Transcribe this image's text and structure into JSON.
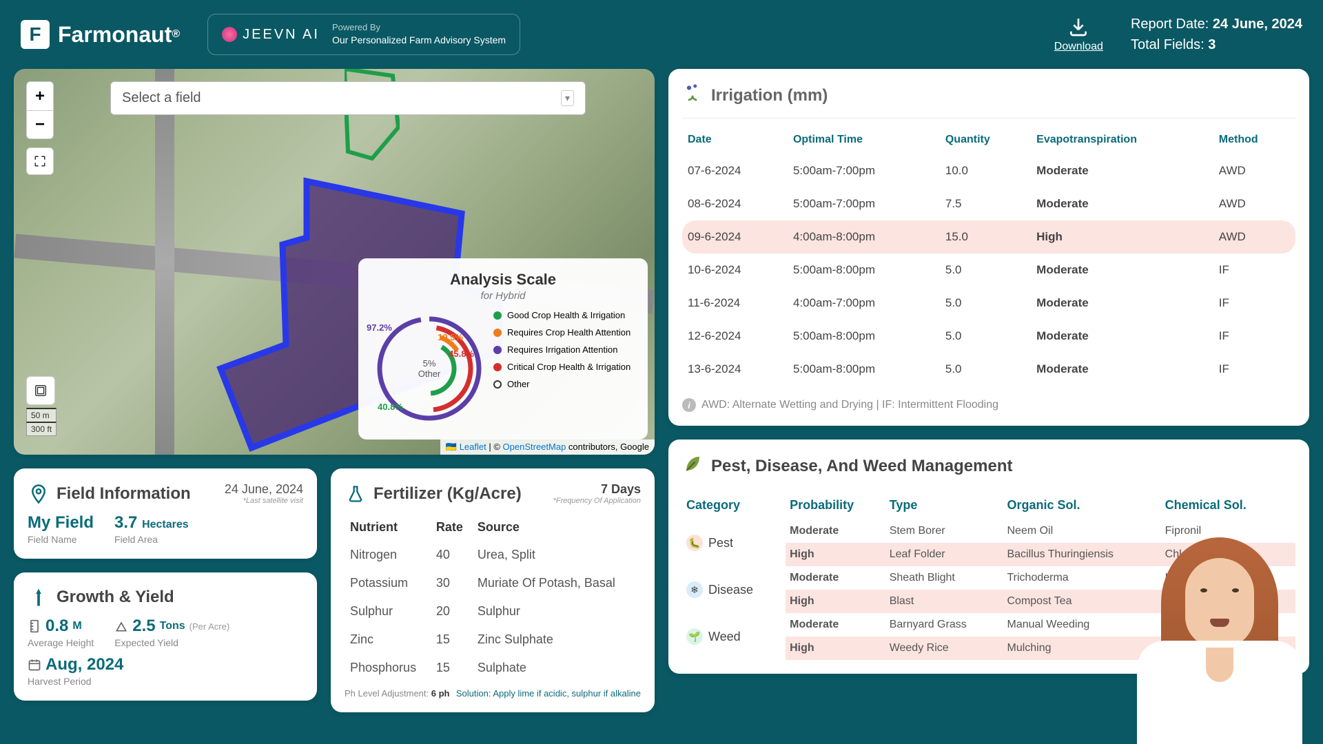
{
  "header": {
    "logo_text": "Farmonaut",
    "logo_reg": "®",
    "jeevn_text": "JEEVN AI",
    "jeevn_powered": "Powered By",
    "jeevn_desc": "Our Personalized Farm Advisory System",
    "download_label": "Download",
    "report_date_label": "Report Date:",
    "report_date": "24 June, 2024",
    "total_fields_label": "Total Fields:",
    "total_fields": "3"
  },
  "map": {
    "select_placeholder": "Select a field",
    "analysis_title": "Analysis Scale",
    "analysis_sub": "for Hybrid",
    "center_pct": "5%",
    "center_lbl": "Other",
    "ring_labels": {
      "purple": "97.2%",
      "orange": "10.5%",
      "red": "45.8%",
      "green": "40.8%"
    },
    "legend": [
      {
        "color": "#1e9e4a",
        "label": "Good Crop Health & Irrigation"
      },
      {
        "color": "#f07d1a",
        "label": "Requires Crop Health Attention"
      },
      {
        "color": "#5b3fa8",
        "label": "Requires Irrigation Attention"
      },
      {
        "color": "#d32f2f",
        "label": "Critical Crop Health & Irrigation"
      },
      {
        "color": "#ffffff",
        "label": "Other"
      }
    ],
    "scale_m": "50 m",
    "scale_ft": "300 ft",
    "attr_leaflet": "Leaflet",
    "attr_osm": "OpenStreetMap",
    "attr_rest": " contributors, Google"
  },
  "field_info": {
    "title": "Field Information",
    "date": "24 June, 2024",
    "date_note": "*Last satellite visit",
    "name_val": "My Field",
    "name_label": "Field Name",
    "area_val": "3.7",
    "area_unit": "Hectares",
    "area_label": "Field Area"
  },
  "growth": {
    "title": "Growth & Yield",
    "height_val": "0.8",
    "height_unit": "M",
    "height_label": "Average Height",
    "yield_val": "2.5",
    "yield_unit": "Tons",
    "yield_per": "(Per Acre)",
    "yield_label": "Expected Yield",
    "harvest_val": "Aug, 2024",
    "harvest_label": "Harvest Period"
  },
  "fertilizer": {
    "title": "Fertilizer (Kg/Acre)",
    "period": "7 Days",
    "period_note": "*Frequency Of Application",
    "cols": {
      "nutrient": "Nutrient",
      "rate": "Rate",
      "source": "Source"
    },
    "rows": [
      {
        "n": "Nitrogen",
        "r": "40",
        "s": "Urea, Split"
      },
      {
        "n": "Potassium",
        "r": "30",
        "s": "Muriate Of Potash, Basal"
      },
      {
        "n": "Sulphur",
        "r": "20",
        "s": "Sulphur"
      },
      {
        "n": "Zinc",
        "r": "15",
        "s": "Zinc Sulphate"
      },
      {
        "n": "Phosphorus",
        "r": "15",
        "s": "Sulphate"
      }
    ],
    "ph_label": "Ph Level Adjustment:",
    "ph_val": "6 ph",
    "sol_label": "Solution:",
    "sol_val": "Apply lime if acidic, sulphur if alkaline"
  },
  "irrigation": {
    "title": "Irrigation (mm)",
    "cols": {
      "date": "Date",
      "time": "Optimal Time",
      "qty": "Quantity",
      "evap": "Evapotranspiration",
      "method": "Method"
    },
    "rows": [
      {
        "date": "07-6-2024",
        "time": "5:00am-7:00pm",
        "qty": "10.0",
        "evap": "Moderate",
        "method": "AWD",
        "high": false
      },
      {
        "date": "08-6-2024",
        "time": "5:00am-7:00pm",
        "qty": "7.5",
        "evap": "Moderate",
        "method": "AWD",
        "high": false
      },
      {
        "date": "09-6-2024",
        "time": "4:00am-8:00pm",
        "qty": "15.0",
        "evap": "High",
        "method": "AWD",
        "high": true
      },
      {
        "date": "10-6-2024",
        "time": "5:00am-8:00pm",
        "qty": "5.0",
        "evap": "Moderate",
        "method": "IF",
        "high": false
      },
      {
        "date": "11-6-2024",
        "time": "4:00am-7:00pm",
        "qty": "5.0",
        "evap": "Moderate",
        "method": "IF",
        "high": false
      },
      {
        "date": "12-6-2024",
        "time": "5:00am-8:00pm",
        "qty": "5.0",
        "evap": "Moderate",
        "method": "IF",
        "high": false
      },
      {
        "date": "13-6-2024",
        "time": "5:00am-8:00pm",
        "qty": "5.0",
        "evap": "Moderate",
        "method": "IF",
        "high": false
      }
    ],
    "footer": "AWD: Alternate Wetting and Drying | IF: Intermittent Flooding"
  },
  "pest": {
    "title": "Pest, Disease, And Weed Management",
    "cols": {
      "cat": "Category",
      "prob": "Probability",
      "type": "Type",
      "org": "Organic Sol.",
      "chem": "Chemical Sol."
    },
    "groups": [
      {
        "cat": "Pest",
        "icon_bg": "#fde0d8",
        "icon": "🐛",
        "rows": [
          {
            "prob": "Moderate",
            "type": "Stem Borer",
            "org": "Neem Oil",
            "chem": "Fipronil",
            "high": false
          },
          {
            "prob": "High",
            "type": "Leaf Folder",
            "org": "Bacillus Thuringiensis",
            "chem": "Chlorantraniliprole",
            "high": true
          }
        ]
      },
      {
        "cat": "Disease",
        "icon_bg": "#d8ecf9",
        "icon": "❄",
        "rows": [
          {
            "prob": "Moderate",
            "type": "Sheath Blight",
            "org": "Trichoderma",
            "chem": "Hexaconazole",
            "high": false
          },
          {
            "prob": "High",
            "type": "Blast",
            "org": "Compost Tea",
            "chem": "",
            "high": true
          }
        ]
      },
      {
        "cat": "Weed",
        "icon_bg": "#d8f5e8",
        "icon": "🌱",
        "rows": [
          {
            "prob": "Moderate",
            "type": "Barnyard Grass",
            "org": "Manual Weeding",
            "chem": "",
            "high": false
          },
          {
            "prob": "High",
            "type": "Weedy Rice",
            "org": "Mulching",
            "chem": "",
            "high": true
          }
        ]
      }
    ]
  }
}
